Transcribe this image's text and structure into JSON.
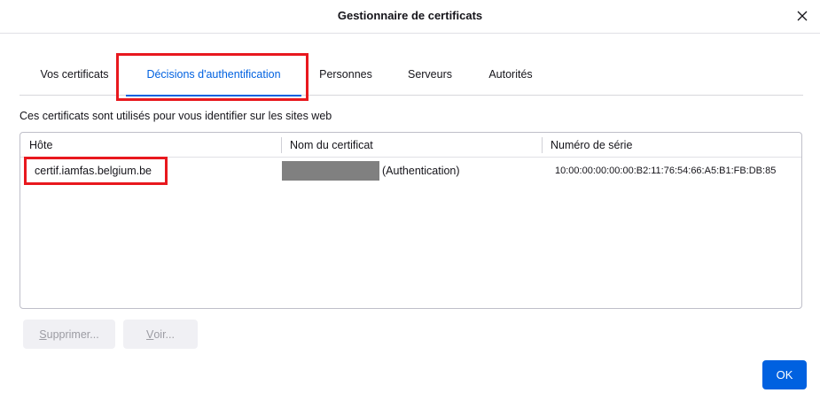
{
  "window": {
    "title": "Gestionnaire de certificats"
  },
  "tabs": [
    {
      "label": "Vos certificats",
      "active": false
    },
    {
      "label": "Décisions d'authentification",
      "active": true
    },
    {
      "label": "Personnes",
      "active": false
    },
    {
      "label": "Serveurs",
      "active": false
    },
    {
      "label": "Autorités",
      "active": false
    }
  ],
  "description": "Ces certificats sont utilisés pour vous identifier sur les sites web",
  "table": {
    "columns": [
      "Hôte",
      "Nom du certificat",
      "Numéro de série"
    ],
    "rows": [
      {
        "host": "certif.iamfas.belgium.be",
        "cert_name_suffix": "(Authentication)",
        "cert_name_redacted": true,
        "serial": "10:00:00:00:00:00:B2:11:76:54:66:A5:B1:FB:DB:85"
      }
    ]
  },
  "buttons": {
    "delete": {
      "prefix": "",
      "mnemonic": "S",
      "rest": "upprimer...",
      "enabled": false
    },
    "view": {
      "prefix": "",
      "mnemonic": "V",
      "rest": "oir...",
      "enabled": false
    },
    "ok": "OK"
  },
  "colors": {
    "accent": "#0061e0",
    "highlight": "#e8181e",
    "redaction": "#808080"
  },
  "icons": {
    "close": "close-icon"
  }
}
